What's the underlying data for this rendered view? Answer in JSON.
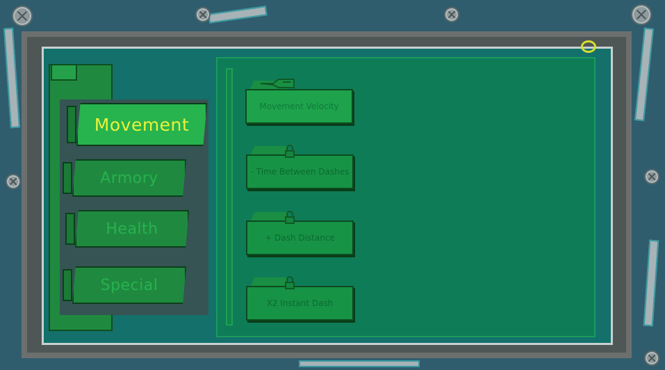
{
  "categories": [
    {
      "label": "Movement",
      "active": true
    },
    {
      "label": "Armory",
      "active": false
    },
    {
      "label": "Health",
      "active": false
    },
    {
      "label": "Special",
      "active": false
    }
  ],
  "upgrades": [
    {
      "label": "Movement Velocity",
      "locked": false,
      "icon": "hand-pointer-icon"
    },
    {
      "label": "- Time Between Dashes",
      "locked": true,
      "icon": "lock-icon"
    },
    {
      "label": "+ Dash Distance",
      "locked": true,
      "icon": "lock-icon"
    },
    {
      "label": "X2 Instant Dash",
      "locked": true,
      "icon": "lock-icon"
    }
  ],
  "colors": {
    "active_label": "#e9f23a",
    "inactive_label": "#28b14f",
    "screen": "#13706b",
    "frame": "#2f5d6d"
  }
}
